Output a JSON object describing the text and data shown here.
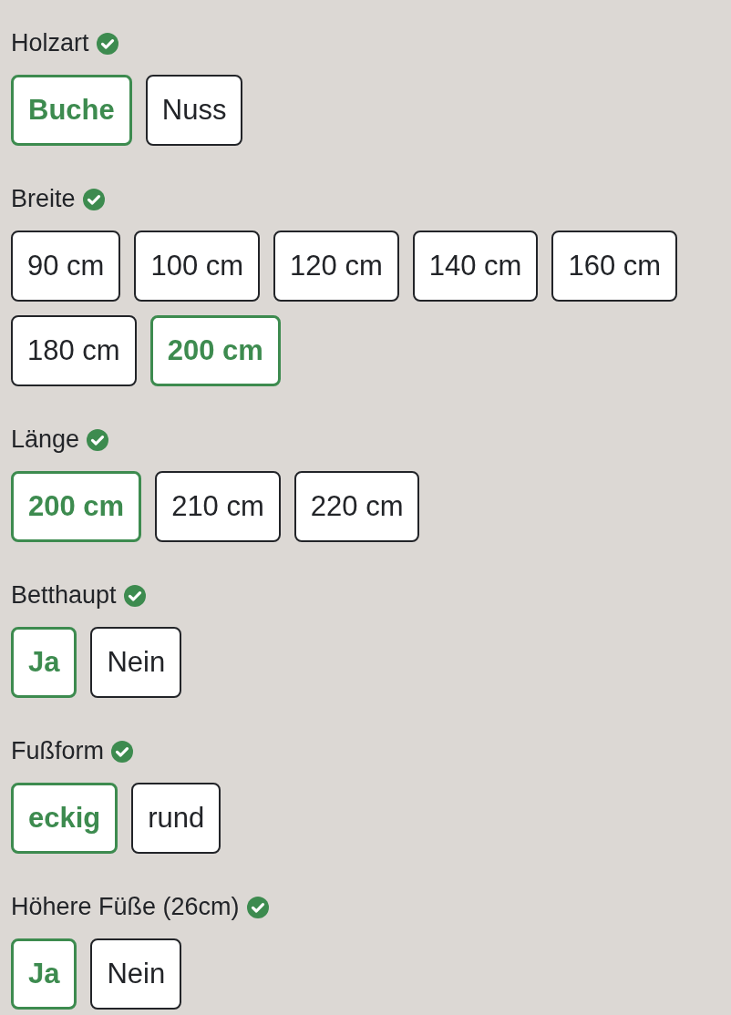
{
  "sections": [
    {
      "label": "Holzart",
      "complete": true,
      "options": [
        {
          "label": "Buche",
          "selected": true
        },
        {
          "label": "Nuss",
          "selected": false
        }
      ]
    },
    {
      "label": "Breite",
      "complete": true,
      "options": [
        {
          "label": "90 cm",
          "selected": false
        },
        {
          "label": "100 cm",
          "selected": false
        },
        {
          "label": "120 cm",
          "selected": false
        },
        {
          "label": "140 cm",
          "selected": false
        },
        {
          "label": "160 cm",
          "selected": false
        },
        {
          "label": "180 cm",
          "selected": false
        },
        {
          "label": "200 cm",
          "selected": true
        }
      ]
    },
    {
      "label": "Länge",
      "complete": true,
      "options": [
        {
          "label": "200 cm",
          "selected": true
        },
        {
          "label": "210 cm",
          "selected": false
        },
        {
          "label": "220 cm",
          "selected": false
        }
      ]
    },
    {
      "label": "Betthaupt",
      "complete": true,
      "options": [
        {
          "label": "Ja",
          "selected": true
        },
        {
          "label": "Nein",
          "selected": false
        }
      ]
    },
    {
      "label": "Fußform",
      "complete": true,
      "options": [
        {
          "label": "eckig",
          "selected": true
        },
        {
          "label": "rund",
          "selected": false
        }
      ]
    },
    {
      "label": "Höhere Füße (26cm)",
      "complete": true,
      "options": [
        {
          "label": "Ja",
          "selected": true
        },
        {
          "label": "Nein",
          "selected": false
        }
      ]
    }
  ]
}
